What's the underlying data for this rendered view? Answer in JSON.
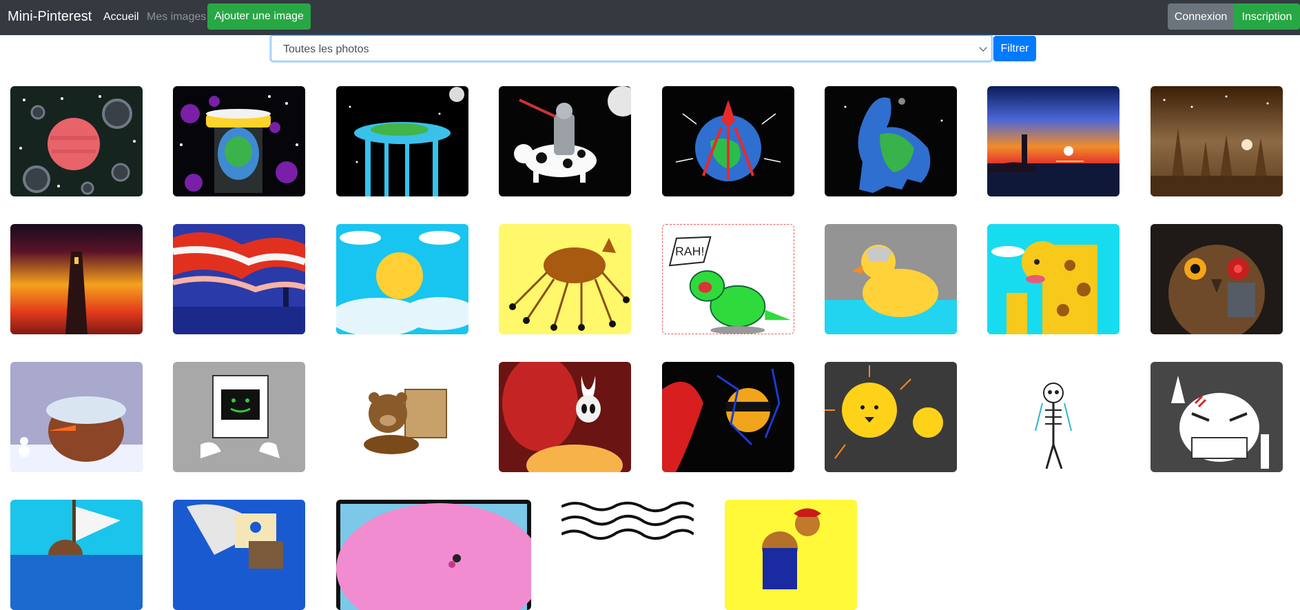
{
  "navbar": {
    "brand": "Mini-Pinterest",
    "links": {
      "home": "Accueil",
      "my_images": "Mes images"
    },
    "add_image": "Ajouter une image",
    "login": "Connexion",
    "signup": "Inscription"
  },
  "filter": {
    "selected": "Toutes les photos",
    "button": "Filtrer"
  },
  "colors": {
    "navbar_bg": "#343a40",
    "success": "#28a745",
    "primary": "#007bff",
    "secondary": "#6c757d"
  },
  "gallery": {
    "image_icons": [
      "planet-space-icon",
      "earth-jar-space-icon",
      "flat-earth-waterfall-icon",
      "knight-riding-cow-icon",
      "squid-planet-icon",
      "earth-dinosaur-icon",
      "lighthouse-sunset-icon",
      "forest-moon-icon",
      "dark-tower-sunset-icon",
      "stormy-sea-icon",
      "sun-clouds-icon",
      "spider-horse-icon",
      "dinosaur-rah-icon",
      "duck-cyborg-icon",
      "giraffe-icon",
      "cyborg-owl-icon",
      "snowman-bird-icon",
      "computer-robot-icon",
      "box-bear-icon",
      "hollow-knight-icon",
      "dark-moon-icon",
      "sun-family-icon",
      "skeleton-icon",
      "angry-skull-icon",
      "pirate-ship-icon",
      "sailing-ship-icon",
      "pink-creature-icon",
      "black-white-pattern-icon",
      "rooster-cowboy-icon"
    ]
  }
}
